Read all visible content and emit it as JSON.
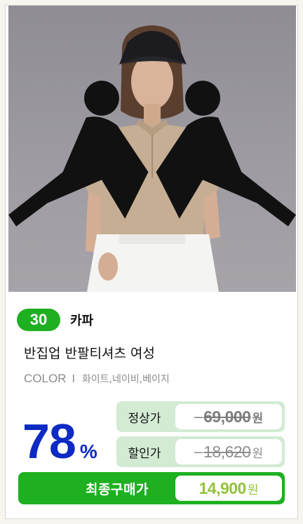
{
  "product": {
    "logo_icon": "kappa-omini-logo",
    "discount_badge": "30",
    "brand": "카파",
    "title": "반집업 반팔티셔츠 여성",
    "color_label": "COLOR",
    "color_separator": "I",
    "colors": "화이트,네이비,베이지",
    "discount_rate": "78",
    "discount_unit": "%"
  },
  "prices": {
    "regular_label": "정상가",
    "regular_value": "69,000",
    "sale_label": "할인가",
    "sale_value": "18,620",
    "final_label": "최종구매가",
    "final_value": "14,900",
    "currency": "원"
  },
  "colors": {
    "accent_green": "#1fb021",
    "light_green": "#d3ead3",
    "discount_blue": "#0d2ac2",
    "final_price_green": "#93c23f"
  }
}
